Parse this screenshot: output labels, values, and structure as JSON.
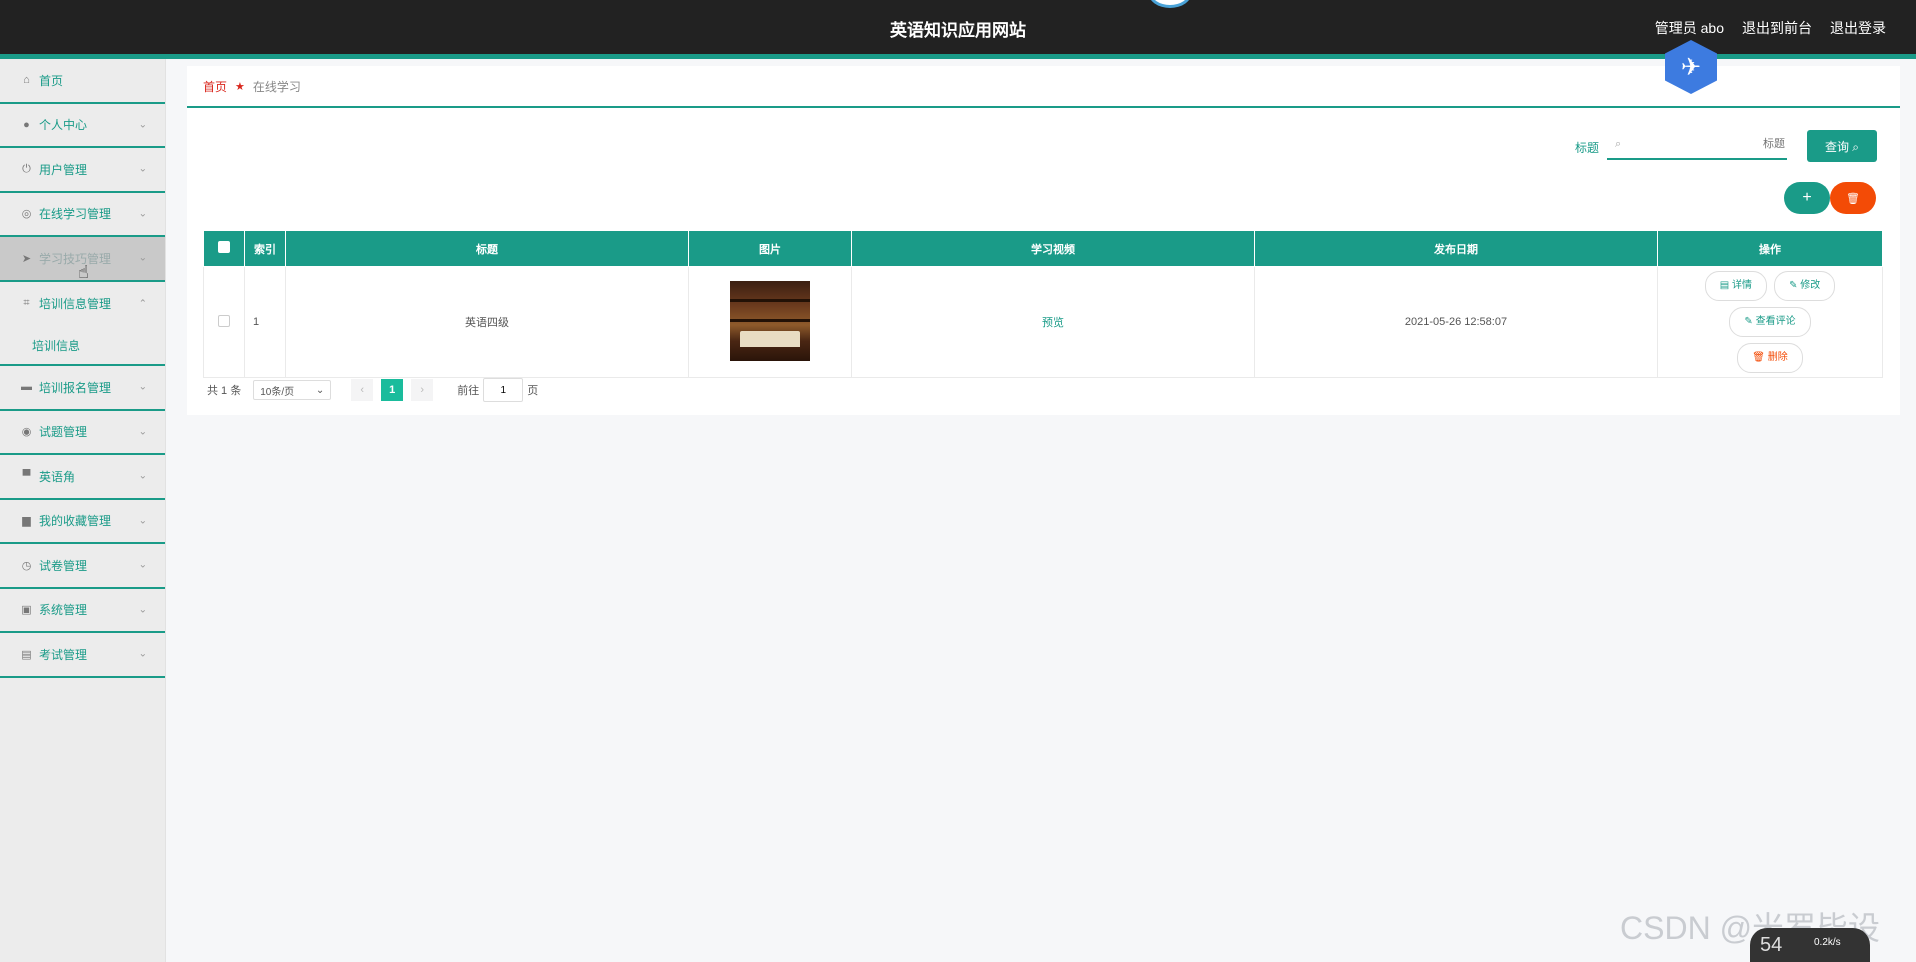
{
  "header": {
    "title": "英语知识应用网站",
    "links": [
      "管理员 abo",
      "退出到前台",
      "退出登录"
    ]
  },
  "sidebar": {
    "items": [
      {
        "label": "首页",
        "icon": "home-icon",
        "arrow": ""
      },
      {
        "label": "个人中心",
        "icon": "user-icon",
        "arrow": "⌄"
      },
      {
        "label": "用户管理",
        "icon": "power-icon",
        "arrow": "⌄"
      },
      {
        "label": "在线学习管理",
        "icon": "compass-icon",
        "arrow": "⌄"
      },
      {
        "label": "学习技巧管理",
        "icon": "send-icon",
        "arrow": "⌄"
      },
      {
        "label": "培训信息管理",
        "icon": "crop-icon",
        "arrow": "⌃"
      },
      {
        "label": "培训报名管理",
        "icon": "chat-icon",
        "arrow": "⌄"
      },
      {
        "label": "试题管理",
        "icon": "globe-icon",
        "arrow": "⌄"
      },
      {
        "label": "英语角",
        "icon": "briefcase-icon",
        "arrow": "⌄"
      },
      {
        "label": "我的收藏管理",
        "icon": "printer-icon",
        "arrow": "⌄"
      },
      {
        "label": "试卷管理",
        "icon": "clock-icon",
        "arrow": "⌄"
      },
      {
        "label": "系统管理",
        "icon": "clipboard-icon",
        "arrow": "⌄"
      },
      {
        "label": "考试管理",
        "icon": "checklist-icon",
        "arrow": "⌄"
      }
    ],
    "submenu": "培训信息"
  },
  "breadcrumb": {
    "home": "首页",
    "current": "在线学习"
  },
  "search": {
    "label": "标题",
    "placeholder": "标题",
    "button": "查询 ⌕"
  },
  "actions": {
    "add": "+",
    "delete": "🗑"
  },
  "table": {
    "headers": [
      "",
      "索引",
      "标题",
      "图片",
      "学习视频",
      "发布日期",
      "操作"
    ],
    "rows": [
      {
        "index": "1",
        "title": "英语四级",
        "video": "预览",
        "date": "2021-05-26 12:58:07",
        "ops": [
          "详情",
          "修改",
          "查看评论",
          "删除"
        ]
      }
    ]
  },
  "pagination": {
    "total": "共 1 条",
    "page_size": "10条/页",
    "current_page": "1",
    "goto_prefix": "前往",
    "goto_value": "1",
    "goto_suffix": "页"
  },
  "watermark": "CSDN @米罗毕设",
  "widget": {
    "percent": "54",
    "rate": "0.2k/s"
  },
  "colors": {
    "accent": "#1a9b88",
    "danger": "#f34b06",
    "header_bg": "#222222"
  }
}
